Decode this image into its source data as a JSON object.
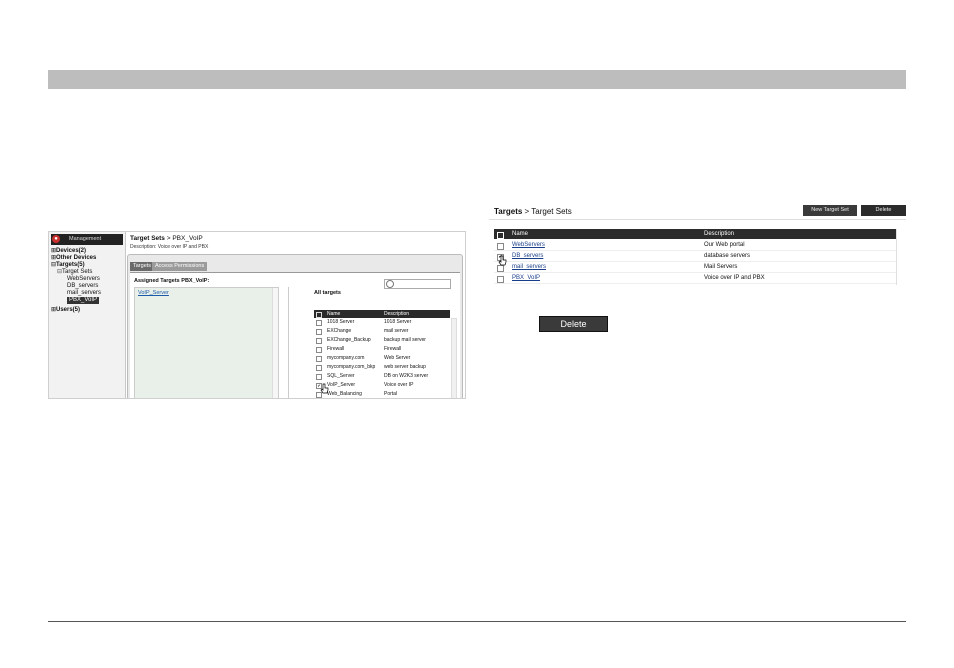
{
  "left_screenshot": {
    "nav": {
      "management_label": "Management",
      "tree": [
        {
          "label": "Devices(2)",
          "bold": true
        },
        {
          "label": "Other Devices",
          "bold": true
        },
        {
          "label": "Targets(5)",
          "bold": true
        },
        {
          "label": "Target Sets",
          "bold": false
        },
        {
          "label": "WebServers",
          "bold": false
        },
        {
          "label": "DB_servers",
          "bold": false
        },
        {
          "label": "mail_servers",
          "bold": false
        },
        {
          "label": "PBX_VoIP",
          "bold": false,
          "selected": true
        },
        {
          "label": "Users(5)",
          "bold": true
        }
      ]
    },
    "breadcrumb_root": "Target Sets",
    "breadcrumb_sep": " > ",
    "breadcrumb_current": "PBX_VoIP",
    "description": "Description: Voice over IP and PBX",
    "tabs": [
      "Targets",
      "Access Permissions"
    ],
    "assigned_heading": "Assigned Targets PBX_VoIP:",
    "assigned_items": [
      "VoIP_Server"
    ],
    "all_heading": "All targets",
    "table_headers": [
      "Name",
      "Description"
    ],
    "table_rows": [
      {
        "name": "1018 Server",
        "desc": "1018 Server",
        "checked": false
      },
      {
        "name": "EXChange",
        "desc": "mail server",
        "checked": false
      },
      {
        "name": "EXChange_Backup",
        "desc": "backup mail server",
        "checked": false
      },
      {
        "name": "Firewall",
        "desc": "Firewall",
        "checked": false
      },
      {
        "name": "mycompany.com",
        "desc": "Web Server",
        "checked": false
      },
      {
        "name": "mycompany.com_bkp",
        "desc": "web server backup",
        "checked": false
      },
      {
        "name": "SQL_Server",
        "desc": "DB on W2K3 server",
        "checked": false
      },
      {
        "name": "VoIP_Server",
        "desc": "Voice over IP",
        "checked": true
      },
      {
        "name": "Web_Balancing",
        "desc": "Portal",
        "checked": false
      }
    ]
  },
  "right_screenshot": {
    "breadcrumb_root": "Targets",
    "breadcrumb_sep": " > ",
    "breadcrumb_current": "Target Sets",
    "new_button": "New Target Set",
    "delete_button": "Delete",
    "table_headers": [
      "Name",
      "Description"
    ],
    "rows": [
      {
        "name": "WebServers",
        "desc": "Our Web portal",
        "checked": false
      },
      {
        "name": "DB_servers",
        "desc": "database servers",
        "checked": true
      },
      {
        "name": "mail_servers",
        "desc": "Mail Servers",
        "checked": false
      },
      {
        "name": "PBX_VoIP",
        "desc": "Voice over IP and PBX",
        "checked": false
      }
    ]
  },
  "delete_button_large": "Delete"
}
